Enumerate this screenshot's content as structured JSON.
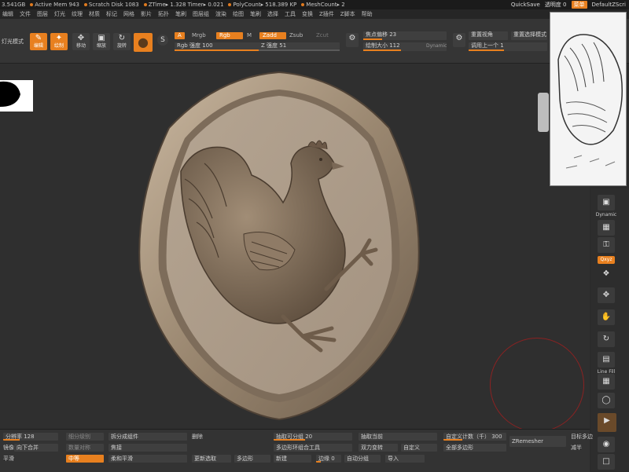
{
  "status": {
    "memory": "3.541GB",
    "active_mem": "Active Mem 943",
    "scratch_disk": "Scratch Disk 1083",
    "ztime": "ZTime▸ 1.328 Timer▸ 0.021",
    "polycount": "PolyCount▸ 518.389 KP",
    "meshcount": "MeshCount▸ 2"
  },
  "topright": {
    "quicksave": "QuickSave",
    "transparency": "透明度 0",
    "menu_chip": "菜单",
    "script": "DefaultZScri"
  },
  "menu": [
    "编辑",
    "文件",
    "图层",
    "灯光",
    "纹理",
    "材质",
    "标记",
    "网格",
    "影片",
    "拓扑",
    "笔刷",
    "图层组",
    "渲染",
    "绘图",
    "笔刷",
    "选择",
    "工具",
    "变换",
    "Z插件",
    "Z脚本",
    "帮助"
  ],
  "toolbar": {
    "left_label": "灯光模式",
    "edit": "编辑",
    "draw": "绘制",
    "move": "移动",
    "scale": "缩放",
    "rotate": "旋转",
    "a_chip": "A",
    "mrgb": "Mrgb",
    "rgb": "Rgb",
    "m": "M",
    "zadd": "Zadd",
    "zsub": "Zsub",
    "zcut": "Zcut",
    "rgb_intensity": "Rgb 强度 100",
    "z_intensity": "Z 强度 51",
    "focal_shift": "焦点偏移 23",
    "draw_size": "绘制大小 112",
    "dynamic": "Dynamic",
    "reset_view": "重置视角",
    "reset_sel": "重置选择模式",
    "last_tool": "调用上一个 1"
  },
  "rightshelf": {
    "dynamic": "Dynamic",
    "xyz": "Qxyz",
    "linefill": "Line Fill"
  },
  "bottom": {
    "subdiv": "分辨率 128",
    "subdiv2": "细分级别",
    "merge_down": "向下合并",
    "split": "拆分成组件",
    "delete": "删除",
    "mirror": "镜像",
    "weld": "焦接",
    "smooth": "平滑",
    "medium": "中等",
    "soft_smooth": "柔和平滑",
    "mask_by": "数量对称",
    "remesh": "更新选取",
    "sharpen": "多边形",
    "extract": "抽取可分组 20",
    "extract2": "抽取当前",
    "poly": "多边形环组合工具",
    "double": "双力变转",
    "custom": "自定义",
    "global": "全部多边形",
    "new": "新建",
    "border": "边缘 0",
    "auto_group": "自动分组",
    "import": "导入",
    "custom_count": "自定义计数（千） 300",
    "zremesher": "ZRemesher",
    "target": "目标多边",
    "half": "减半"
  },
  "colors": {
    "accent": "#e8801f",
    "bg": "#2b2b2b",
    "relief": "#a0907c"
  },
  "icons": [
    "edit-icon",
    "draw-icon",
    "move-icon",
    "scale-icon",
    "rotate-icon",
    "sphere-brush-icon",
    "gear-icon",
    "reference-image",
    "relief-model"
  ]
}
